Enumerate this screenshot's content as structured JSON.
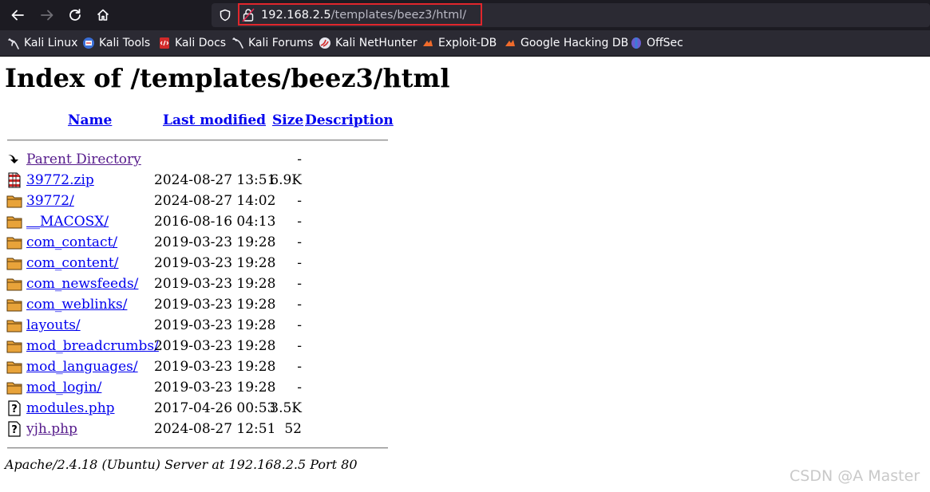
{
  "browser": {
    "url_host": "192.168.2.5",
    "url_path": "/templates/beez3/html/",
    "bookmarks": [
      {
        "label": "Kali Linux",
        "icon": "kali-dragon-icon"
      },
      {
        "label": "Kali Tools",
        "icon": "kali-tools-icon"
      },
      {
        "label": "Kali Docs",
        "icon": "kali-docs-icon"
      },
      {
        "label": "Kali Forums",
        "icon": "kali-forums-icon"
      },
      {
        "label": "Kali NetHunter",
        "icon": "nethunter-icon"
      },
      {
        "label": "Exploit-DB",
        "icon": "exploit-db-icon"
      },
      {
        "label": "Google Hacking DB",
        "icon": "ghdb-icon"
      },
      {
        "label": "OffSec",
        "icon": "offsec-icon"
      }
    ]
  },
  "page": {
    "title": "Index of /templates/beez3/html",
    "columns": {
      "name": "Name",
      "modified": "Last modified",
      "size": "Size",
      "description": "Description"
    },
    "entries": [
      {
        "name": "Parent Directory",
        "modified": "",
        "size": "-",
        "icon": "back-arrow-icon",
        "visited": true
      },
      {
        "name": "39772.zip",
        "modified": "2024-08-27 13:51",
        "size": "6.9K",
        "icon": "archive-icon",
        "visited": false
      },
      {
        "name": "39772/",
        "modified": "2024-08-27 14:02",
        "size": "-",
        "icon": "folder-icon",
        "visited": false
      },
      {
        "name": "__MACOSX/",
        "modified": "2016-08-16 04:13",
        "size": "-",
        "icon": "folder-icon",
        "visited": false
      },
      {
        "name": "com_contact/",
        "modified": "2019-03-23 19:28",
        "size": "-",
        "icon": "folder-icon",
        "visited": false
      },
      {
        "name": "com_content/",
        "modified": "2019-03-23 19:28",
        "size": "-",
        "icon": "folder-icon",
        "visited": false
      },
      {
        "name": "com_newsfeeds/",
        "modified": "2019-03-23 19:28",
        "size": "-",
        "icon": "folder-icon",
        "visited": false
      },
      {
        "name": "com_weblinks/",
        "modified": "2019-03-23 19:28",
        "size": "-",
        "icon": "folder-icon",
        "visited": false
      },
      {
        "name": "layouts/",
        "modified": "2019-03-23 19:28",
        "size": "-",
        "icon": "folder-icon",
        "visited": false
      },
      {
        "name": "mod_breadcrumbs/",
        "modified": "2019-03-23 19:28",
        "size": "-",
        "icon": "folder-icon",
        "visited": false
      },
      {
        "name": "mod_languages/",
        "modified": "2019-03-23 19:28",
        "size": "-",
        "icon": "folder-icon",
        "visited": false
      },
      {
        "name": "mod_login/",
        "modified": "2019-03-23 19:28",
        "size": "-",
        "icon": "folder-icon",
        "visited": false
      },
      {
        "name": "modules.php",
        "modified": "2017-04-26 00:53",
        "size": "3.5K",
        "icon": "unknown-file-icon",
        "visited": false
      },
      {
        "name": "yjh.php",
        "modified": "2024-08-27 12:51",
        "size": "52",
        "icon": "unknown-file-icon",
        "visited": true
      }
    ],
    "footer": "Apache/2.4.18 (Ubuntu) Server at 192.168.2.5 Port 80"
  },
  "watermark": "CSDN @A Master"
}
